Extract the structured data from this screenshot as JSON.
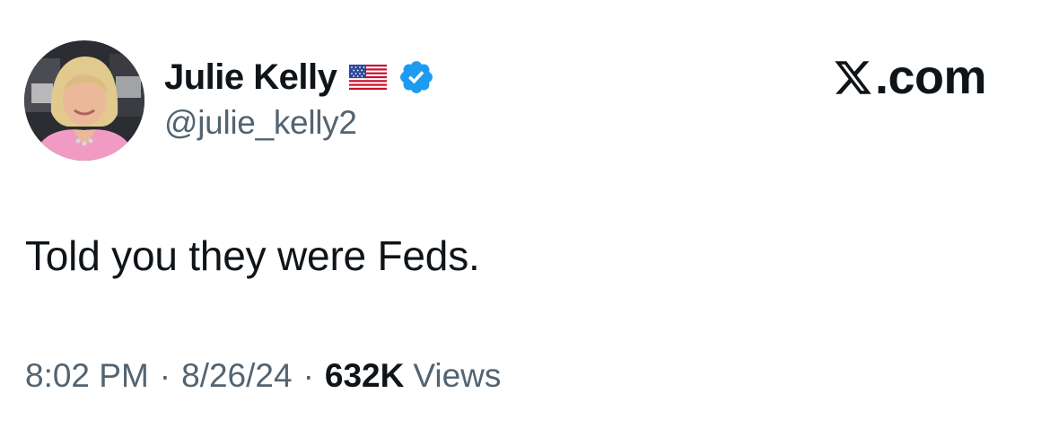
{
  "author": {
    "display_name": "Julie Kelly",
    "handle": "@julie_kelly2",
    "flag_icon": "us-flag-icon",
    "verified_icon": "verified-badge-icon",
    "verified_color": "#1d9bf0"
  },
  "brand": {
    "logo_icon": "x-logo-icon",
    "suffix": ".com"
  },
  "tweet": {
    "text": "Told you they were Feds."
  },
  "meta": {
    "time": "8:02 PM",
    "separator": "·",
    "date": "8/26/24",
    "views_count": "632K",
    "views_label": "Views"
  },
  "colors": {
    "text_primary": "#0f1419",
    "text_secondary": "#536471",
    "background": "#ffffff"
  }
}
